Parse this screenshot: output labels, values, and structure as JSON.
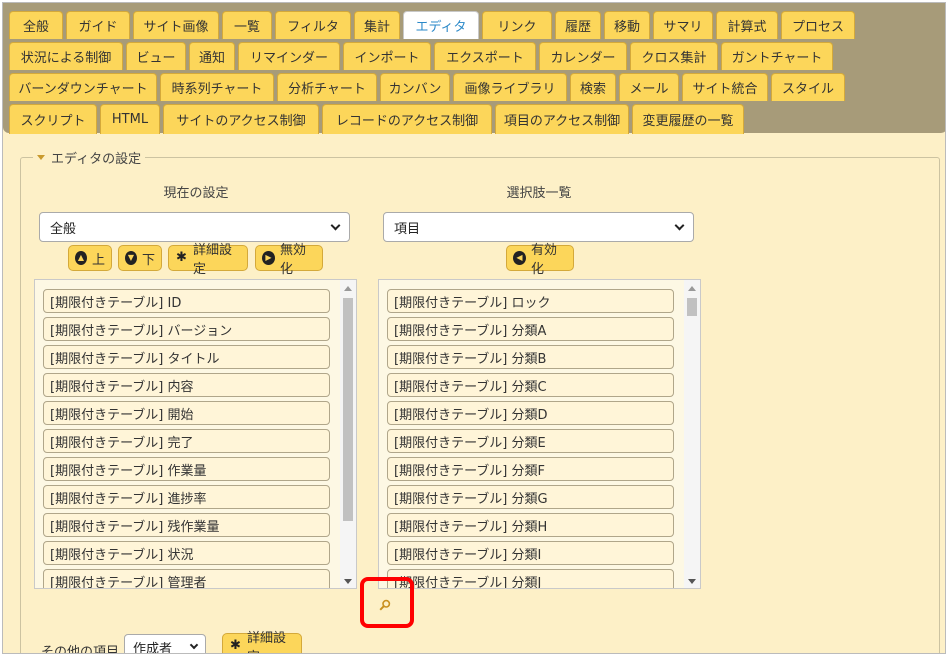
{
  "tabs": {
    "row1": [
      "全般",
      "ガイド",
      "サイト画像",
      "一覧",
      "フィルタ",
      "集計",
      "エディタ",
      "リンク",
      "履歴",
      "移動",
      "サマリ",
      "計算式",
      "プロセス"
    ],
    "row2": [
      "状況による制御",
      "ビュー",
      "通知",
      "リマインダー",
      "インポート",
      "エクスポート",
      "カレンダー",
      "クロス集計",
      "ガントチャート"
    ],
    "row3": [
      "バーンダウンチャート",
      "時系列チャート",
      "分析チャート",
      "カンバン",
      "画像ライブラリ",
      "検索",
      "メール",
      "サイト統合",
      "スタイル"
    ],
    "row4": [
      "スクリプト",
      "HTML",
      "サイトのアクセス制御",
      "レコードのアクセス制御",
      "項目のアクセス制御",
      "変更履歴の一覧"
    ],
    "active": "エディタ"
  },
  "section": {
    "legend": "エディタの設定"
  },
  "current": {
    "title": "現在の設定",
    "select_value": "全般",
    "buttons": {
      "up": "上",
      "down": "下",
      "detail": "詳細設定",
      "disable": "無効化"
    },
    "items": [
      "[期限付きテーブル] ID",
      "[期限付きテーブル] バージョン",
      "[期限付きテーブル] タイトル",
      "[期限付きテーブル] 内容",
      "[期限付きテーブル] 開始",
      "[期限付きテーブル] 完了",
      "[期限付きテーブル] 作業量",
      "[期限付きテーブル] 進捗率",
      "[期限付きテーブル] 残作業量",
      "[期限付きテーブル] 状況",
      "[期限付きテーブル] 管理者"
    ]
  },
  "options": {
    "title": "選択肢一覧",
    "select_value": "項目",
    "buttons": {
      "enable": "有効化"
    },
    "items": [
      "[期限付きテーブル] ロック",
      "[期限付きテーブル] 分類A",
      "[期限付きテーブル] 分類B",
      "[期限付きテーブル] 分類C",
      "[期限付きテーブル] 分類D",
      "[期限付きテーブル] 分類E",
      "[期限付きテーブル] 分類F",
      "[期限付きテーブル] 分類G",
      "[期限付きテーブル] 分類H",
      "[期限付きテーブル] 分類I",
      "[期限付きテーブル] 分類J"
    ]
  },
  "other": {
    "label": "その他の項目",
    "select_value": "作成者",
    "detail_button": "詳細設定"
  },
  "icons": {
    "search": "search-icon",
    "gear": "gear-icon",
    "up": "arrow-up-icon",
    "down": "arrow-down-icon",
    "disable": "arrow-right-icon",
    "enable": "arrow-left-icon"
  },
  "colors": {
    "tab": "#fcd65a",
    "tabbar": "#a79b79",
    "panel": "#fdf0c7",
    "active_tab_text": "#2a88c8",
    "highlight": "#ff0000"
  }
}
